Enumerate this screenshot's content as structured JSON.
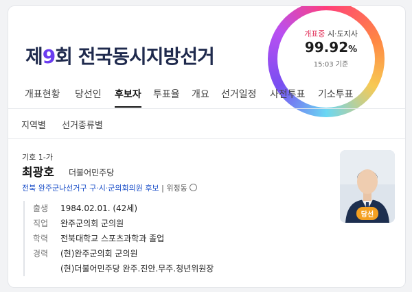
{
  "banner": {
    "title_prefix": "제",
    "title_number": "9",
    "title_suffix": "회 전국동시지방선거",
    "gauge_label_highlight": "개표중",
    "gauge_label_rest": "시·도지사",
    "gauge_value": "99.92",
    "gauge_unit": "%",
    "gauge_time": "15:03 기준",
    "gauge_progress": 0.9992
  },
  "tabs": [
    "개표현황",
    "당선인",
    "후보자",
    "투표율",
    "개요",
    "선거일정",
    "사전투표",
    "기소투표"
  ],
  "active_tab": "후보자",
  "subtabs": [
    "지역별",
    "선거종류별"
  ],
  "candidate": {
    "number_label": "기호 1-가",
    "name": "최광호",
    "party": "더불어민주당",
    "election_line": "전북 완주군나선거구 구·시·군의회의원 후보",
    "extra_label": "| 위정동",
    "badge": "당선",
    "info": [
      {
        "key": "출생",
        "values": [
          "1984.02.01. (42세)"
        ]
      },
      {
        "key": "직업",
        "values": [
          "완주군의회 군의원"
        ]
      },
      {
        "key": "학력",
        "values": [
          "전북대학교 스포츠과학과 졸업"
        ]
      },
      {
        "key": "경력",
        "values": [
          "(현)완주군의회 군의원",
          "(현)더불어민주당 완주.진안.무주.청년위원장"
        ]
      }
    ]
  },
  "colors": {
    "accent_purple": "#6a3cf0",
    "link_blue": "#1a4ec8",
    "badge_orange": "#f4a021",
    "gauge_pink": "#e2335b"
  },
  "icons": [
    "person-photo",
    "circle-icon"
  ]
}
